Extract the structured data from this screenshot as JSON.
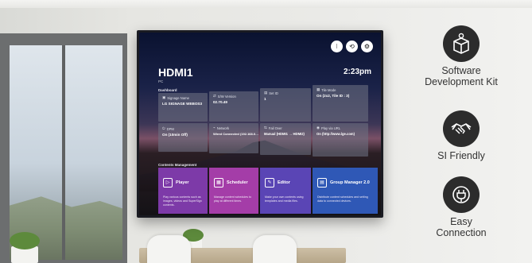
{
  "screen": {
    "input_name": "HDMI1",
    "input_sub": "PC",
    "clock": "2:23pm",
    "top_icons": [
      "grid-icon",
      "back-icon",
      "gear-icon"
    ],
    "dashboard_label": "Dashboard",
    "tiles": [
      {
        "title": "Signage Name",
        "value": "LG SIGNAGE WEBOS3",
        "icon": "signage-icon"
      },
      {
        "title": "S/W Version",
        "value": "02.70.49",
        "icon": "version-icon"
      },
      {
        "title": "Set ID",
        "value": "1",
        "icon": "setid-icon"
      },
      {
        "title": "Tile Mode",
        "value": "On (2x2, Tile ID : 3)",
        "icon": "tile-icon"
      },
      {
        "title": "DPM",
        "value": "On (10min Off)",
        "icon": "dpm-icon"
      },
      {
        "title": "Network",
        "value": "Wired Connected (192.168.0…",
        "icon": "network-icon"
      },
      {
        "title": "Fail Over",
        "value": "Manual (HDMI1 → HDMI2)",
        "icon": "failover-icon"
      },
      {
        "title": "Play via URL",
        "value": "On (http://www.lge.com)",
        "icon": "url-icon"
      }
    ],
    "contents_label": "Contents Management",
    "cards": [
      {
        "title": "Player",
        "desc": "Play various contents such as images, videos and SuperSign contents.",
        "color": "#7d3aa8"
      },
      {
        "title": "Scheduler",
        "desc": "Manage content schedules to play at different times.",
        "color": "#a43da8"
      },
      {
        "title": "Editor",
        "desc": "Make your own contents using templates and media files.",
        "color": "#5a45b5"
      },
      {
        "title": "Group Manager 2.0",
        "desc": "Distribute content schedules and setting data to connected devices.",
        "color": "#2f58b6"
      }
    ]
  },
  "features": [
    {
      "label_line1": "Software",
      "label_line2": "Development Kit",
      "icon": "sdk-box-icon"
    },
    {
      "label_line1": "SI Friendly",
      "label_line2": "",
      "icon": "handshake-icon"
    },
    {
      "label_line1": "Easy",
      "label_line2": "Connection",
      "icon": "plug-icon"
    }
  ]
}
